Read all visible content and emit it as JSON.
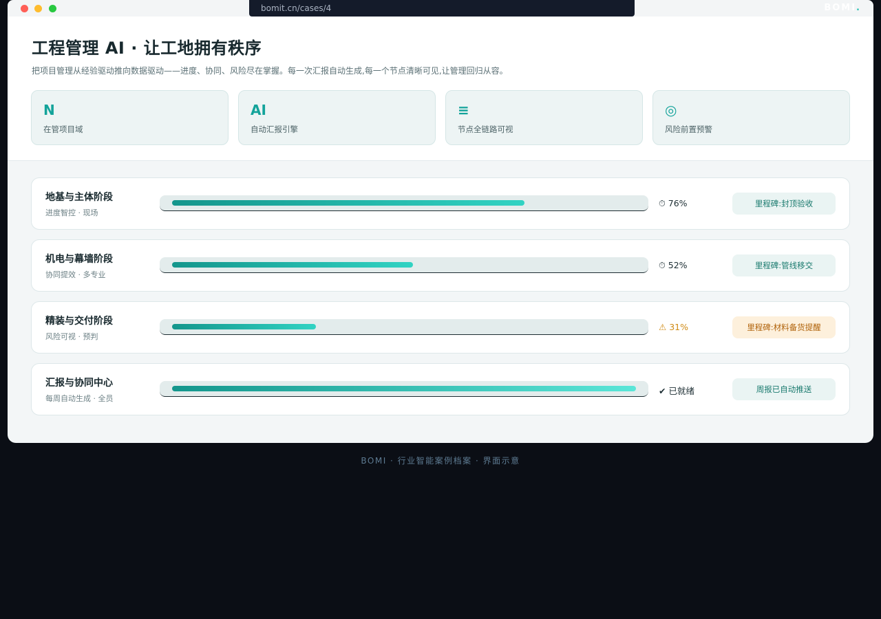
{
  "browser": {
    "url": "bomit.cn/cases/4",
    "brand": "BOMI",
    "brand_dot": "."
  },
  "header": {
    "title": "工程管理 AI · 让工地拥有秩序",
    "subtitle": "把项目管理从经验驱动推向数据驱动——进度、协同、风险尽在掌握。每一次汇报自动生成,每一个节点清晰可见,让管理回归从容。"
  },
  "stats": [
    {
      "icon": "N",
      "icon_name": "letter-n-icon",
      "label": "在管项目域"
    },
    {
      "icon": "AI",
      "icon_name": "ai-icon",
      "label": "自动汇报引擎"
    },
    {
      "icon": "≡",
      "icon_name": "list-icon",
      "label": "节点全链路可视"
    },
    {
      "icon": "◎",
      "icon_name": "target-icon",
      "label": "风险前置预警"
    }
  ],
  "phases": [
    {
      "title": "地基与主体阶段",
      "tags": "进度智控 · 现场",
      "progress": 0.76,
      "status_icon": "⏱",
      "status_text": "76%",
      "milestone": "里程碑:封顶验收",
      "state": "normal"
    },
    {
      "title": "机电与幕墙阶段",
      "tags": "协同提效 · 多专业",
      "progress": 0.52,
      "status_icon": "⏱",
      "status_text": "52%",
      "milestone": "里程碑:管线移交",
      "state": "normal"
    },
    {
      "title": "精装与交付阶段",
      "tags": "风险可视 · 预判",
      "progress": 0.31,
      "status_icon": "⚠",
      "status_text": "31%",
      "milestone": "里程碑:材料备货提醒",
      "state": "warn"
    },
    {
      "title": "汇报与协同中心",
      "tags": "每周自动生成 · 全员",
      "progress": 1.0,
      "status_icon": "✔",
      "status_text": "已就绪",
      "milestone": "周报已自动推送",
      "state": "normal"
    }
  ],
  "footer": "BOMI · 行业智能案例档案 · 界面示意",
  "colors": {
    "accent": "#13a39a",
    "warn": "#d08b16",
    "background": "#0b0e15"
  }
}
